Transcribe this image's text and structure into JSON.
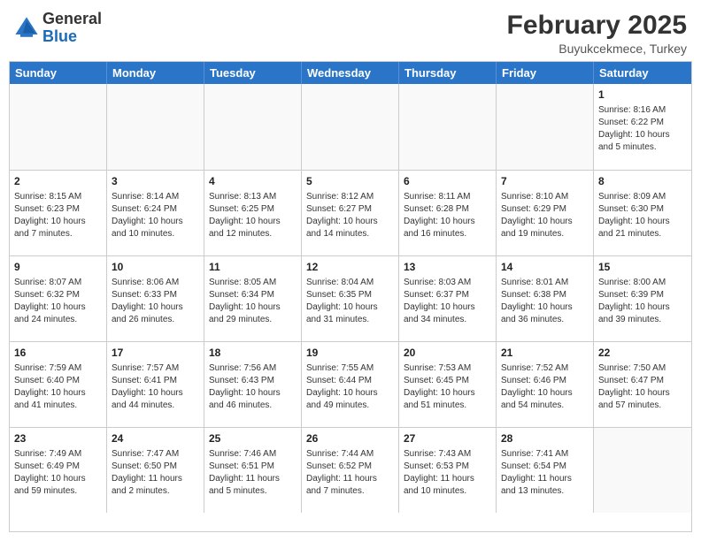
{
  "header": {
    "logo_general": "General",
    "logo_blue": "Blue",
    "month_year": "February 2025",
    "location": "Buyukcekmece, Turkey"
  },
  "weekdays": [
    "Sunday",
    "Monday",
    "Tuesday",
    "Wednesday",
    "Thursday",
    "Friday",
    "Saturday"
  ],
  "rows": [
    [
      {
        "day": "",
        "info": ""
      },
      {
        "day": "",
        "info": ""
      },
      {
        "day": "",
        "info": ""
      },
      {
        "day": "",
        "info": ""
      },
      {
        "day": "",
        "info": ""
      },
      {
        "day": "",
        "info": ""
      },
      {
        "day": "1",
        "info": "Sunrise: 8:16 AM\nSunset: 6:22 PM\nDaylight: 10 hours\nand 5 minutes."
      }
    ],
    [
      {
        "day": "2",
        "info": "Sunrise: 8:15 AM\nSunset: 6:23 PM\nDaylight: 10 hours\nand 7 minutes."
      },
      {
        "day": "3",
        "info": "Sunrise: 8:14 AM\nSunset: 6:24 PM\nDaylight: 10 hours\nand 10 minutes."
      },
      {
        "day": "4",
        "info": "Sunrise: 8:13 AM\nSunset: 6:25 PM\nDaylight: 10 hours\nand 12 minutes."
      },
      {
        "day": "5",
        "info": "Sunrise: 8:12 AM\nSunset: 6:27 PM\nDaylight: 10 hours\nand 14 minutes."
      },
      {
        "day": "6",
        "info": "Sunrise: 8:11 AM\nSunset: 6:28 PM\nDaylight: 10 hours\nand 16 minutes."
      },
      {
        "day": "7",
        "info": "Sunrise: 8:10 AM\nSunset: 6:29 PM\nDaylight: 10 hours\nand 19 minutes."
      },
      {
        "day": "8",
        "info": "Sunrise: 8:09 AM\nSunset: 6:30 PM\nDaylight: 10 hours\nand 21 minutes."
      }
    ],
    [
      {
        "day": "9",
        "info": "Sunrise: 8:07 AM\nSunset: 6:32 PM\nDaylight: 10 hours\nand 24 minutes."
      },
      {
        "day": "10",
        "info": "Sunrise: 8:06 AM\nSunset: 6:33 PM\nDaylight: 10 hours\nand 26 minutes."
      },
      {
        "day": "11",
        "info": "Sunrise: 8:05 AM\nSunset: 6:34 PM\nDaylight: 10 hours\nand 29 minutes."
      },
      {
        "day": "12",
        "info": "Sunrise: 8:04 AM\nSunset: 6:35 PM\nDaylight: 10 hours\nand 31 minutes."
      },
      {
        "day": "13",
        "info": "Sunrise: 8:03 AM\nSunset: 6:37 PM\nDaylight: 10 hours\nand 34 minutes."
      },
      {
        "day": "14",
        "info": "Sunrise: 8:01 AM\nSunset: 6:38 PM\nDaylight: 10 hours\nand 36 minutes."
      },
      {
        "day": "15",
        "info": "Sunrise: 8:00 AM\nSunset: 6:39 PM\nDaylight: 10 hours\nand 39 minutes."
      }
    ],
    [
      {
        "day": "16",
        "info": "Sunrise: 7:59 AM\nSunset: 6:40 PM\nDaylight: 10 hours\nand 41 minutes."
      },
      {
        "day": "17",
        "info": "Sunrise: 7:57 AM\nSunset: 6:41 PM\nDaylight: 10 hours\nand 44 minutes."
      },
      {
        "day": "18",
        "info": "Sunrise: 7:56 AM\nSunset: 6:43 PM\nDaylight: 10 hours\nand 46 minutes."
      },
      {
        "day": "19",
        "info": "Sunrise: 7:55 AM\nSunset: 6:44 PM\nDaylight: 10 hours\nand 49 minutes."
      },
      {
        "day": "20",
        "info": "Sunrise: 7:53 AM\nSunset: 6:45 PM\nDaylight: 10 hours\nand 51 minutes."
      },
      {
        "day": "21",
        "info": "Sunrise: 7:52 AM\nSunset: 6:46 PM\nDaylight: 10 hours\nand 54 minutes."
      },
      {
        "day": "22",
        "info": "Sunrise: 7:50 AM\nSunset: 6:47 PM\nDaylight: 10 hours\nand 57 minutes."
      }
    ],
    [
      {
        "day": "23",
        "info": "Sunrise: 7:49 AM\nSunset: 6:49 PM\nDaylight: 10 hours\nand 59 minutes."
      },
      {
        "day": "24",
        "info": "Sunrise: 7:47 AM\nSunset: 6:50 PM\nDaylight: 11 hours\nand 2 minutes."
      },
      {
        "day": "25",
        "info": "Sunrise: 7:46 AM\nSunset: 6:51 PM\nDaylight: 11 hours\nand 5 minutes."
      },
      {
        "day": "26",
        "info": "Sunrise: 7:44 AM\nSunset: 6:52 PM\nDaylight: 11 hours\nand 7 minutes."
      },
      {
        "day": "27",
        "info": "Sunrise: 7:43 AM\nSunset: 6:53 PM\nDaylight: 11 hours\nand 10 minutes."
      },
      {
        "day": "28",
        "info": "Sunrise: 7:41 AM\nSunset: 6:54 PM\nDaylight: 11 hours\nand 13 minutes."
      },
      {
        "day": "",
        "info": ""
      }
    ]
  ]
}
